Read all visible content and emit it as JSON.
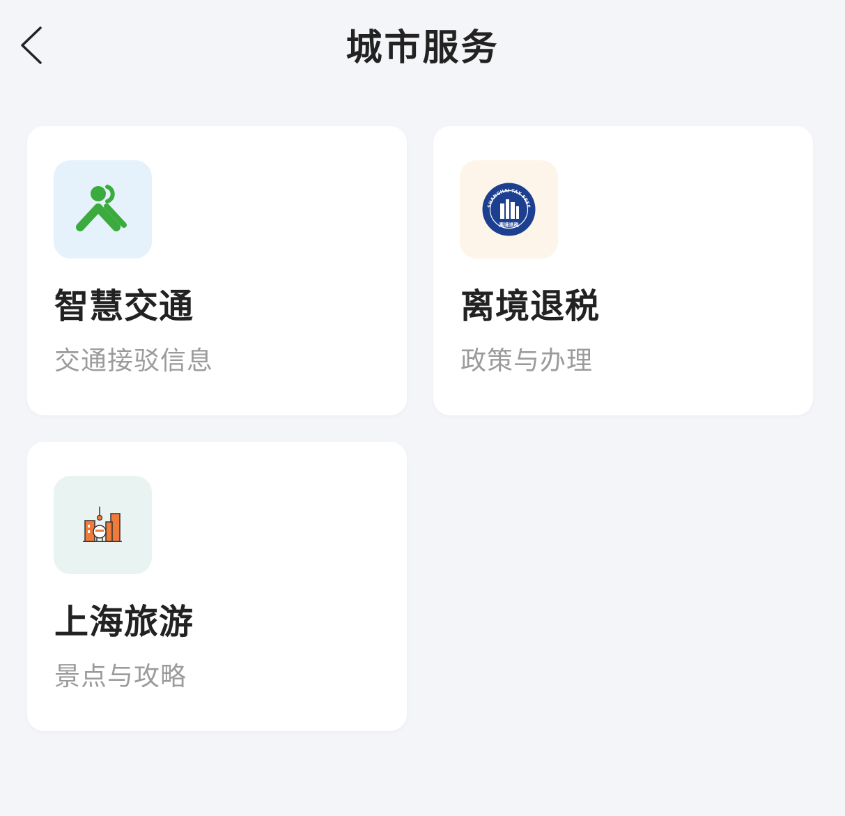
{
  "header": {
    "title": "城市服务",
    "back_icon": "chevron-left-icon"
  },
  "cards": [
    {
      "title": "智慧交通",
      "subtitle": "交通接驳信息",
      "icon": "metro-people-icon",
      "icon_bg": "#e6f2fb",
      "icon_color": "#3aab3c"
    },
    {
      "title": "离境退税",
      "subtitle": "政策与办理",
      "icon": "shanghai-tax-free-seal-icon",
      "icon_bg": "#fdf5e9",
      "icon_color": "#1c3f8f",
      "seal_text_top": "SHANGHAI TAX FREE",
      "seal_text_bottom": "离境退税"
    },
    {
      "title": "上海旅游",
      "subtitle": "景点与攻略",
      "icon": "shanghai-skyline-icon",
      "icon_bg": "#e9f3f1",
      "icon_color": "#f07a3a"
    }
  ]
}
